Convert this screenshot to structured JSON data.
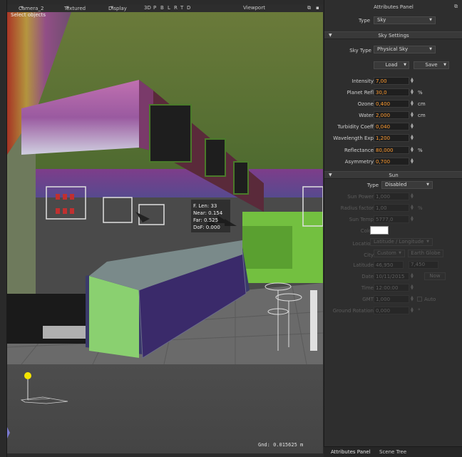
{
  "viewport": {
    "camera": "Camera_2",
    "shading": "Textured",
    "display": "Display",
    "axes": [
      "3D",
      "P",
      "B",
      "L",
      "R",
      "T",
      "D"
    ],
    "title": "Viewport",
    "select_objects": "Select objects",
    "focal_info": [
      "F. Len: 33",
      "Near: 0.154",
      "Far: 0.525",
      "DoF: 0.000"
    ],
    "grid_readout": "Gnd: 0.015625 m"
  },
  "panel": {
    "title": "Attributes Panel",
    "type_label": "Type",
    "type_value": "Sky",
    "sky_settings": {
      "header": "Sky Settings",
      "sky_type_label": "Sky Type",
      "sky_type_value": "Physical Sky",
      "load_label": "Load",
      "save_label": "Save",
      "fields": [
        {
          "label": "Intensity",
          "value": "7,00",
          "unit": ""
        },
        {
          "label": "Planet Refl",
          "value": "30,0",
          "unit": "%"
        },
        {
          "label": "Ozone",
          "value": "0,400",
          "unit": "cm"
        },
        {
          "label": "Water",
          "value": "2,000",
          "unit": "cm"
        },
        {
          "label": "Turbidity Coeff",
          "value": "0,040",
          "unit": ""
        },
        {
          "label": "Wavelength Exp",
          "value": "1,200",
          "unit": ""
        },
        {
          "label": "Reflectance",
          "value": "80,000",
          "unit": "%"
        },
        {
          "label": "Asymmetry",
          "value": "0,700",
          "unit": ""
        }
      ]
    },
    "sun": {
      "header": "Sun",
      "type_label": "Type",
      "type_value": "Disabled",
      "sun_power_label": "Sun Power",
      "sun_power_value": "1,000",
      "radius_label": "Radius factor",
      "radius_value": "1,00",
      "radius_unit": "%",
      "sun_temp_label": "Sun Temp",
      "sun_temp_value": "5777,0",
      "color_label": "Color",
      "location_label": "Location",
      "location_value": "Latitude / Longitude",
      "city_label": "City",
      "city_value": "Custom",
      "earth_globe_label": "Earth Globe",
      "latitude_label": "Latitude",
      "latitude_value": "46,950",
      "longitude_value": "7,450",
      "date_label": "Date",
      "date_value": "10/11/2015",
      "now_label": "Now",
      "time_label": "Time",
      "time_value": "12:00:00",
      "gmt_label": "GMT",
      "gmt_value": "1,000",
      "auto_label": "Auto",
      "ground_rotation_label": "Ground Rotation",
      "ground_rotation_value": "0,000",
      "ground_rotation_unit": "°"
    },
    "tabs": [
      "Attributes Panel",
      "Scene Tree"
    ]
  },
  "colors": {
    "accent_value": "#ff9a2e",
    "panel_bg": "#2e2e2e",
    "color_swatch": "#ffffff"
  }
}
